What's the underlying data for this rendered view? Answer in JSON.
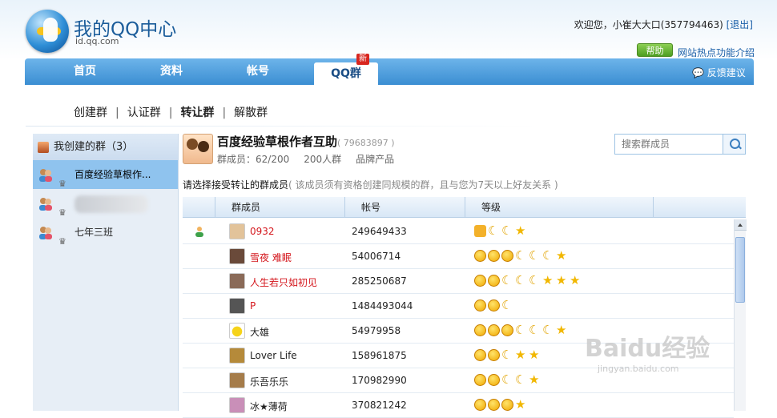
{
  "header": {
    "title": "我的QQ中心",
    "subtitle": "id.qq.com",
    "welcome_prefix": "欢迎您，小崔大大口(357794463) ",
    "logout": "[退出]",
    "help": "帮助",
    "hot_link": "网站热点功能介绍"
  },
  "nav": {
    "items": [
      {
        "label": "首页"
      },
      {
        "label": "资料"
      },
      {
        "label": "帐号"
      },
      {
        "label": "QQ群"
      }
    ],
    "new_badge": "新",
    "feedback": "反馈建议"
  },
  "subnav": {
    "create": "创建群",
    "verify": "认证群",
    "transfer": "转让群",
    "dissolve": "解散群",
    "sep": "|"
  },
  "sidebar": {
    "title": "我创建的群（3）",
    "groups": [
      {
        "label": "百度经验草根作..."
      },
      {
        "label": ""
      },
      {
        "label": "七年三班"
      }
    ]
  },
  "group": {
    "name": "百度经验草根作者互助",
    "id": "( 79683897 )",
    "members": "群成员：62/200",
    "size": "200人群",
    "product": "品牌产品"
  },
  "search": {
    "placeholder": "搜索群成员"
  },
  "instruction": {
    "main": "请选择接受转让的群成员",
    "note": "( 该成员须有资格创建同规模的群，且与您为7天以上好友关系 )"
  },
  "table": {
    "headers": [
      "群成员",
      "帐号",
      "等级"
    ],
    "rows": [
      {
        "nick": "0932",
        "account": "249649433",
        "red": true,
        "level": [
          "crown",
          "moon",
          "moon",
          "star"
        ]
      },
      {
        "nick": "雪夜  难眠",
        "account": "54006714",
        "red": true,
        "level": [
          "face",
          "face",
          "face",
          "moon",
          "moon",
          "moon",
          "star"
        ]
      },
      {
        "nick": "人生若只如初见",
        "account": "285250687",
        "red": true,
        "level": [
          "face",
          "face",
          "moon",
          "moon",
          "moon",
          "star",
          "star",
          "star"
        ]
      },
      {
        "nick": "P",
        "account": "1484493044",
        "red": true,
        "level": [
          "face",
          "face",
          "moon"
        ]
      },
      {
        "nick": "大雄",
        "account": "54979958",
        "red": false,
        "level": [
          "face",
          "face",
          "face",
          "moon",
          "moon",
          "moon",
          "star"
        ]
      },
      {
        "nick": "Lover Life",
        "account": "158961875",
        "red": false,
        "level": [
          "face",
          "face",
          "moon",
          "star",
          "star"
        ]
      },
      {
        "nick": "乐吾乐乐",
        "account": "170982990",
        "red": false,
        "level": [
          "face",
          "face",
          "moon",
          "moon",
          "star"
        ]
      },
      {
        "nick": "冰★薄荷",
        "account": "370821242",
        "red": false,
        "level": [
          "face",
          "face",
          "face",
          "star"
        ]
      }
    ]
  },
  "watermark": {
    "main": "Baidu经验",
    "sub": "jingyan.baidu.com"
  }
}
